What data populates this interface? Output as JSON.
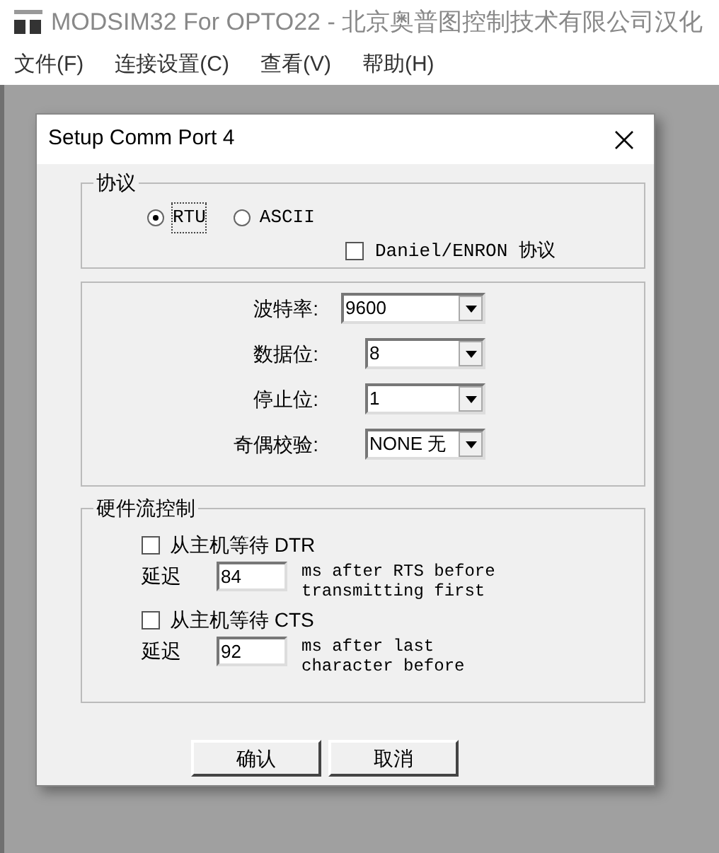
{
  "app": {
    "title": "MODSIM32 For OPTO22 - 北京奥普图控制技术有限公司汉化"
  },
  "menu": [
    "文件(F)",
    "连接设置(C)",
    "查看(V)",
    "帮助(H)"
  ],
  "dialog": {
    "title": "Setup Comm Port 4",
    "protocol": {
      "label": "协议",
      "options": [
        {
          "label": "RTU",
          "selected": true
        },
        {
          "label": "ASCII",
          "selected": false
        }
      ],
      "daniel": {
        "label": "Daniel/ENRON 协议",
        "checked": false
      }
    },
    "settings": [
      {
        "label": "波特率:",
        "value": "9600"
      },
      {
        "label": "数据位:",
        "value": "8"
      },
      {
        "label": "停止位:",
        "value": "1"
      },
      {
        "label": "奇偶校验:",
        "value": "NONE 无"
      }
    ],
    "flow": {
      "label": "硬件流控制",
      "items": [
        {
          "label": "从主机等待 DTR",
          "checked": false,
          "delay_label": "延迟",
          "delay": "84",
          "note": [
            "ms after RTS before",
            "transmitting first"
          ]
        },
        {
          "label": "从主机等待 CTS",
          "checked": false,
          "delay_label": "延迟",
          "delay": "92",
          "note": [
            "ms after last",
            "character before"
          ]
        }
      ]
    },
    "buttons": [
      "确认",
      "取消"
    ]
  }
}
